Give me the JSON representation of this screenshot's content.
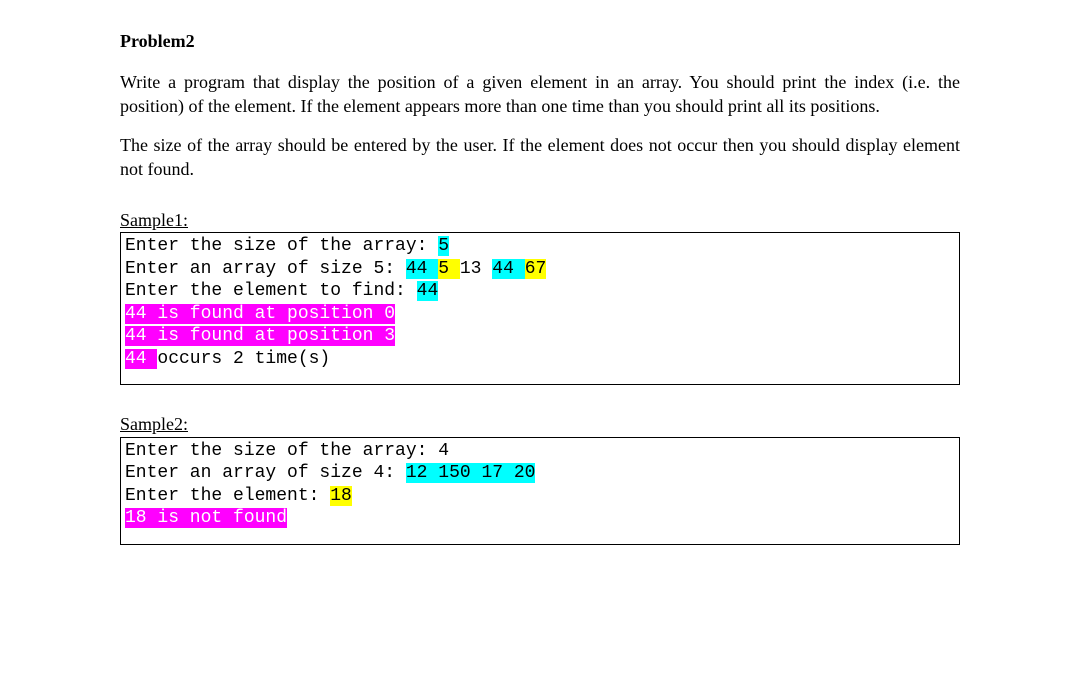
{
  "heading": "Problem2",
  "para1": "Write a program that display the position of a given element in an array. You should print the index (i.e. the position) of the element. If the element appears more than one time than you should print all its positions.",
  "para2": "The size of the array should be entered by the user. If the element does not occur then you should display element not found.",
  "sample1": {
    "label": "Sample1:",
    "line1_prompt": "Enter the size of the array: ",
    "line1_val": "5",
    "line2_prompt": "Enter an array of size 5: ",
    "line2_v1": "44 ",
    "line2_v2": "5 ",
    "line2_v3": "13 ",
    "line2_v4": "44 ",
    "line2_v5": "67",
    "line3_prompt": "Enter the element to find: ",
    "line3_val": "44",
    "line4": "44 is found at position 0",
    "line5": "44 is found at position 3",
    "line6_a": "44 ",
    "line6_b": "occurs 2 time(s)"
  },
  "sample2": {
    "label": "Sample2:",
    "line1_prompt": "Enter the size of the array: ",
    "line1_val": "4",
    "line2_prompt": "Enter an array of size 4: ",
    "line2_val": "12 150 17 20",
    "line3_prompt": "Enter the element: ",
    "line3_val": "18",
    "line4": "18 is not found"
  }
}
